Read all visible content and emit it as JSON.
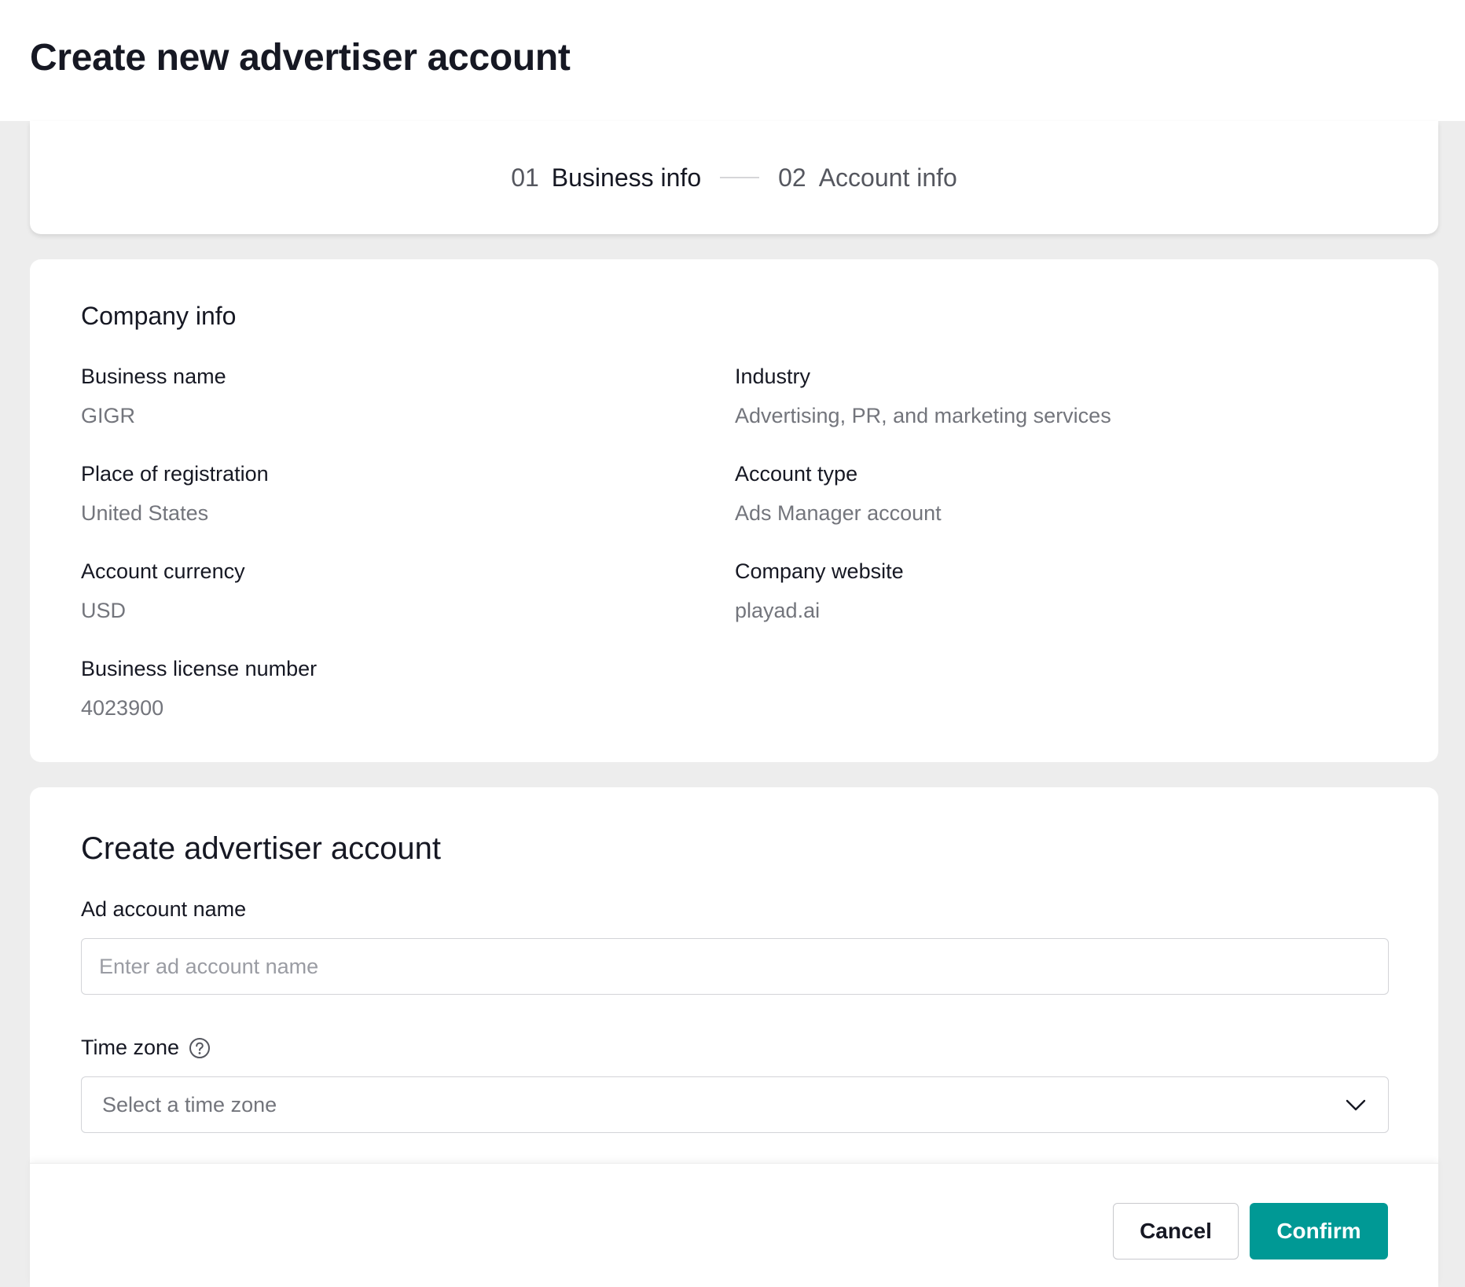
{
  "page": {
    "title": "Create new advertiser account"
  },
  "stepper": {
    "steps": [
      {
        "number": "01",
        "label": "Business info",
        "state": "active"
      },
      {
        "number": "02",
        "label": "Account info",
        "state": "inactive"
      }
    ]
  },
  "company_info": {
    "title": "Company info",
    "fields": [
      {
        "label": "Business name",
        "value": "GIGR"
      },
      {
        "label": "Industry",
        "value": "Advertising, PR, and marketing services"
      },
      {
        "label": "Place of registration",
        "value": "United States"
      },
      {
        "label": "Account type",
        "value": "Ads Manager account"
      },
      {
        "label": "Account currency",
        "value": "USD"
      },
      {
        "label": "Company website",
        "value": "playad.ai"
      },
      {
        "label": "Business license number",
        "value": "4023900"
      }
    ]
  },
  "create_account": {
    "title": "Create advertiser account",
    "ad_account_name": {
      "label": "Ad account name",
      "value": "",
      "placeholder": "Enter ad account name"
    },
    "time_zone": {
      "label": "Time zone",
      "help_icon": "question-circle-icon",
      "placeholder": "Select a time zone",
      "dropdown_icon": "chevron-down-icon"
    }
  },
  "footer": {
    "cancel_label": "Cancel",
    "confirm_label": "Confirm"
  },
  "colors": {
    "primary": "#009995",
    "page_background": "#ededed",
    "text_primary": "#161823",
    "text_secondary": "#73757c"
  }
}
